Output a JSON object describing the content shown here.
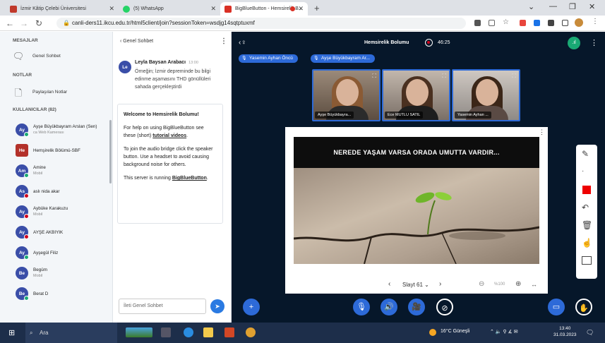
{
  "browser": {
    "tabs": [
      {
        "label": "İzmir Kâtip Çelebi Üniversitesi",
        "color": "#c0392b"
      },
      {
        "label": "(5) WhatsApp",
        "color": "#25d366"
      },
      {
        "label": "BigBlueButton - Hemsirelik B...",
        "color": "#d93025"
      }
    ],
    "new_tab": "+",
    "url": "canli-ders11.ikcu.edu.tr/html5client/join?sessionToken=wsdjg14sqtptuxmf"
  },
  "sidebar": {
    "messages_header": "MESAJLAR",
    "public_chat": "Genel Sohbet",
    "notes_header": "NOTLAR",
    "shared_notes": "Paylaşılan Notlar",
    "users_header": "KULLANICILAR (82)",
    "users": [
      {
        "initials": "Ay",
        "name": "Ayşe Büyükbayram Arslan (Sen)",
        "sub": "ca Web Kamerası",
        "status": "green",
        "square": false,
        "red": false
      },
      {
        "initials": "He",
        "name": "Hemşirelik Bölümü-SBF",
        "sub": "",
        "status": "",
        "square": true,
        "red": true
      },
      {
        "initials": "Am",
        "name": "Amine",
        "sub": "Mobil",
        "status": "green",
        "square": false,
        "red": false
      },
      {
        "initials": "As",
        "name": "aslı nida akar",
        "sub": "",
        "status": "red",
        "square": false,
        "red": false
      },
      {
        "initials": "Ay",
        "name": "Aybüke Karakuzu",
        "sub": "Mobil",
        "status": "red",
        "square": false,
        "red": false
      },
      {
        "initials": "Ay",
        "name": "AYŞE AKBIYIK",
        "sub": "",
        "status": "red",
        "square": false,
        "red": false
      },
      {
        "initials": "Ay",
        "name": "Ayşegül Filiz",
        "sub": "",
        "status": "green",
        "square": false,
        "red": false
      },
      {
        "initials": "Be",
        "name": "Begüm",
        "sub": "Mobil",
        "status": "",
        "square": false,
        "red": false
      },
      {
        "initials": "Be",
        "name": "Berat D",
        "sub": "",
        "status": "green",
        "square": false,
        "red": false
      }
    ]
  },
  "chat": {
    "header": "Genel Sohbet",
    "message": {
      "initials": "Le",
      "author": "Leyla Baysan Arabacı",
      "time": "13:00",
      "text": "Örneğin; İzmir depreminde bu bilgi edinme aşamasını THD gönüllüleri sahada gerçekleştirdi"
    },
    "welcome": {
      "title_prefix": "Welcome to ",
      "title_room": "Hemsirelik Bolumu",
      "title_suffix": "!",
      "help_1": "For help on using BigBlueButton see these (short) ",
      "help_link": "tutorial videos",
      "help_2": ".",
      "audio": "To join the audio bridge click the speaker button. Use a headset to avoid causing background noise for others.",
      "running": "This server is running ",
      "running_link": "BigBlueButton",
      "running_end": "."
    },
    "input_placeholder": "İleti Genel Sohbet"
  },
  "meeting": {
    "title": "Hemsirelik Bolumu",
    "record_time": "46:25",
    "talkers": [
      "Yasemin Ayhan Öncü",
      "Ayşe Büyükbayram Ar..."
    ],
    "webcams": [
      {
        "name": "Ayşe Büyükbayra..."
      },
      {
        "name": "Ece MUTLU SATIL"
      },
      {
        "name": "Yasemin Ayhan ..."
      }
    ],
    "slide_text": "NEREDE YAŞAM VARSA ORADA UMUTTA VARDIR...",
    "slide_label": "Slayt 61",
    "zoom": "%100"
  },
  "taskbar": {
    "search": "Ara",
    "weather": "16°C  Güneşli",
    "time": "13:40",
    "date": "31.03.2023"
  }
}
